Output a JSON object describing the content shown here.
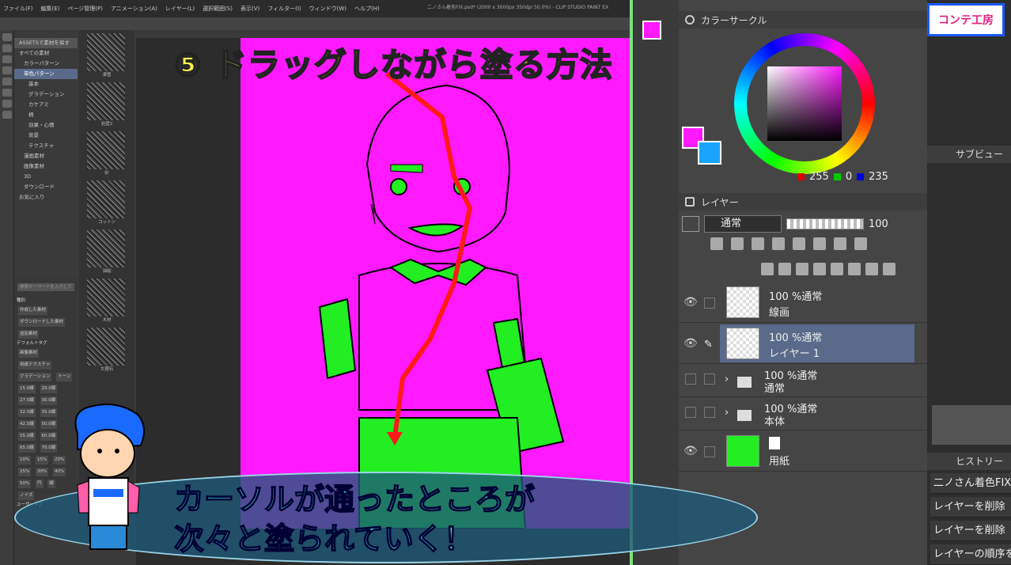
{
  "app": {
    "window_title": "二ノさん着色FIX.psd* (2000 x 3000px 350dpi 50.0%) - CLIP STUDIO PAINT EX",
    "menu": [
      "ファイル(F)",
      "編集(E)",
      "ページ管理(P)",
      "アニメーション(A)",
      "レイヤー(L)",
      "選択範囲(S)",
      "表示(V)",
      "フィルター(I)",
      "ウィンドウ(W)",
      "ヘルプ(H)"
    ]
  },
  "material_panel": {
    "assets_label": "ASSETSで素材を探す",
    "tree": [
      {
        "label": "すべての素材"
      },
      {
        "label": "カラーパターン"
      },
      {
        "label": "単色パターン",
        "selected": true
      },
      {
        "label": "基本"
      },
      {
        "label": "グラデーション"
      },
      {
        "label": "カケアミ"
      },
      {
        "label": "柄"
      },
      {
        "label": "効果・心情"
      },
      {
        "label": "背景"
      },
      {
        "label": "テクスチャ"
      },
      {
        "label": "漫画素材"
      },
      {
        "label": "画像素材"
      },
      {
        "label": "3D"
      },
      {
        "label": "ダウンロード"
      },
      {
        "label": "お気に入り"
      }
    ],
    "thumbs": [
      "凍雪",
      "岩壁2",
      "砂",
      "コットン",
      "油絵",
      "木材",
      "大理石"
    ],
    "search_placeholder": "検索キーワードを入力して",
    "tags": [
      "作成した素材",
      "ダウンロードした素材",
      "追加素材",
      "画像素材",
      "用紙テクスチャ",
      "グラデーション",
      "トーン",
      "15.0線",
      "20.0線",
      "27.5線",
      "30.0線",
      "32.5線",
      "35.0線",
      "42.5線",
      "50.0線",
      "55.0線",
      "60.0線",
      "65.0線",
      "70.0線",
      "10%",
      "15%",
      "20%",
      "25%",
      "30%",
      "40%",
      "50%",
      "円",
      "線",
      "ノイズ"
    ],
    "tag_group_labels": [
      "種別",
      "デフォルトタグ",
      "ユーザータグ"
    ]
  },
  "color_panel": {
    "title": "カラーサークル",
    "main_color": "#ff19ff",
    "sub_color": "#1aa3ff",
    "r": "255",
    "g": "0",
    "b": "235"
  },
  "layer_panel": {
    "title": "レイヤー",
    "blend_mode": "通常",
    "opacity": "100",
    "layers": [
      {
        "mode": "100 %通常",
        "name": "線画",
        "type": "raster",
        "visible": true
      },
      {
        "mode": "100 %通常",
        "name": "レイヤー 1",
        "type": "raster",
        "visible": true,
        "selected": true
      },
      {
        "mode": "100 %通常",
        "name": "通常",
        "type": "folder",
        "visible": false
      },
      {
        "mode": "100 %通常",
        "name": "本体",
        "type": "folder",
        "visible": false
      },
      {
        "mode": "",
        "name": "用紙",
        "type": "paper",
        "visible": true
      }
    ]
  },
  "far_right": {
    "sub_view_title": "サブビュー",
    "history_title": "ヒストリー",
    "history": [
      "二ノさん着色FIX",
      "レイヤーを削除",
      "レイヤーを削除",
      "レイヤーの順序を"
    ]
  },
  "overlay": {
    "logo_text": "コンテ工房",
    "headline": "⑤ ドラッグしながら塗る方法",
    "caption_line1": "カーソルが通ったところが",
    "caption_line2": "次々と塗られていく！"
  },
  "colors": {
    "canvas_fill": "#ff19ff",
    "character_fill": "#22ee22",
    "stroke_red": "#ff1a1a",
    "panel_selected": "#5a6a8a"
  }
}
